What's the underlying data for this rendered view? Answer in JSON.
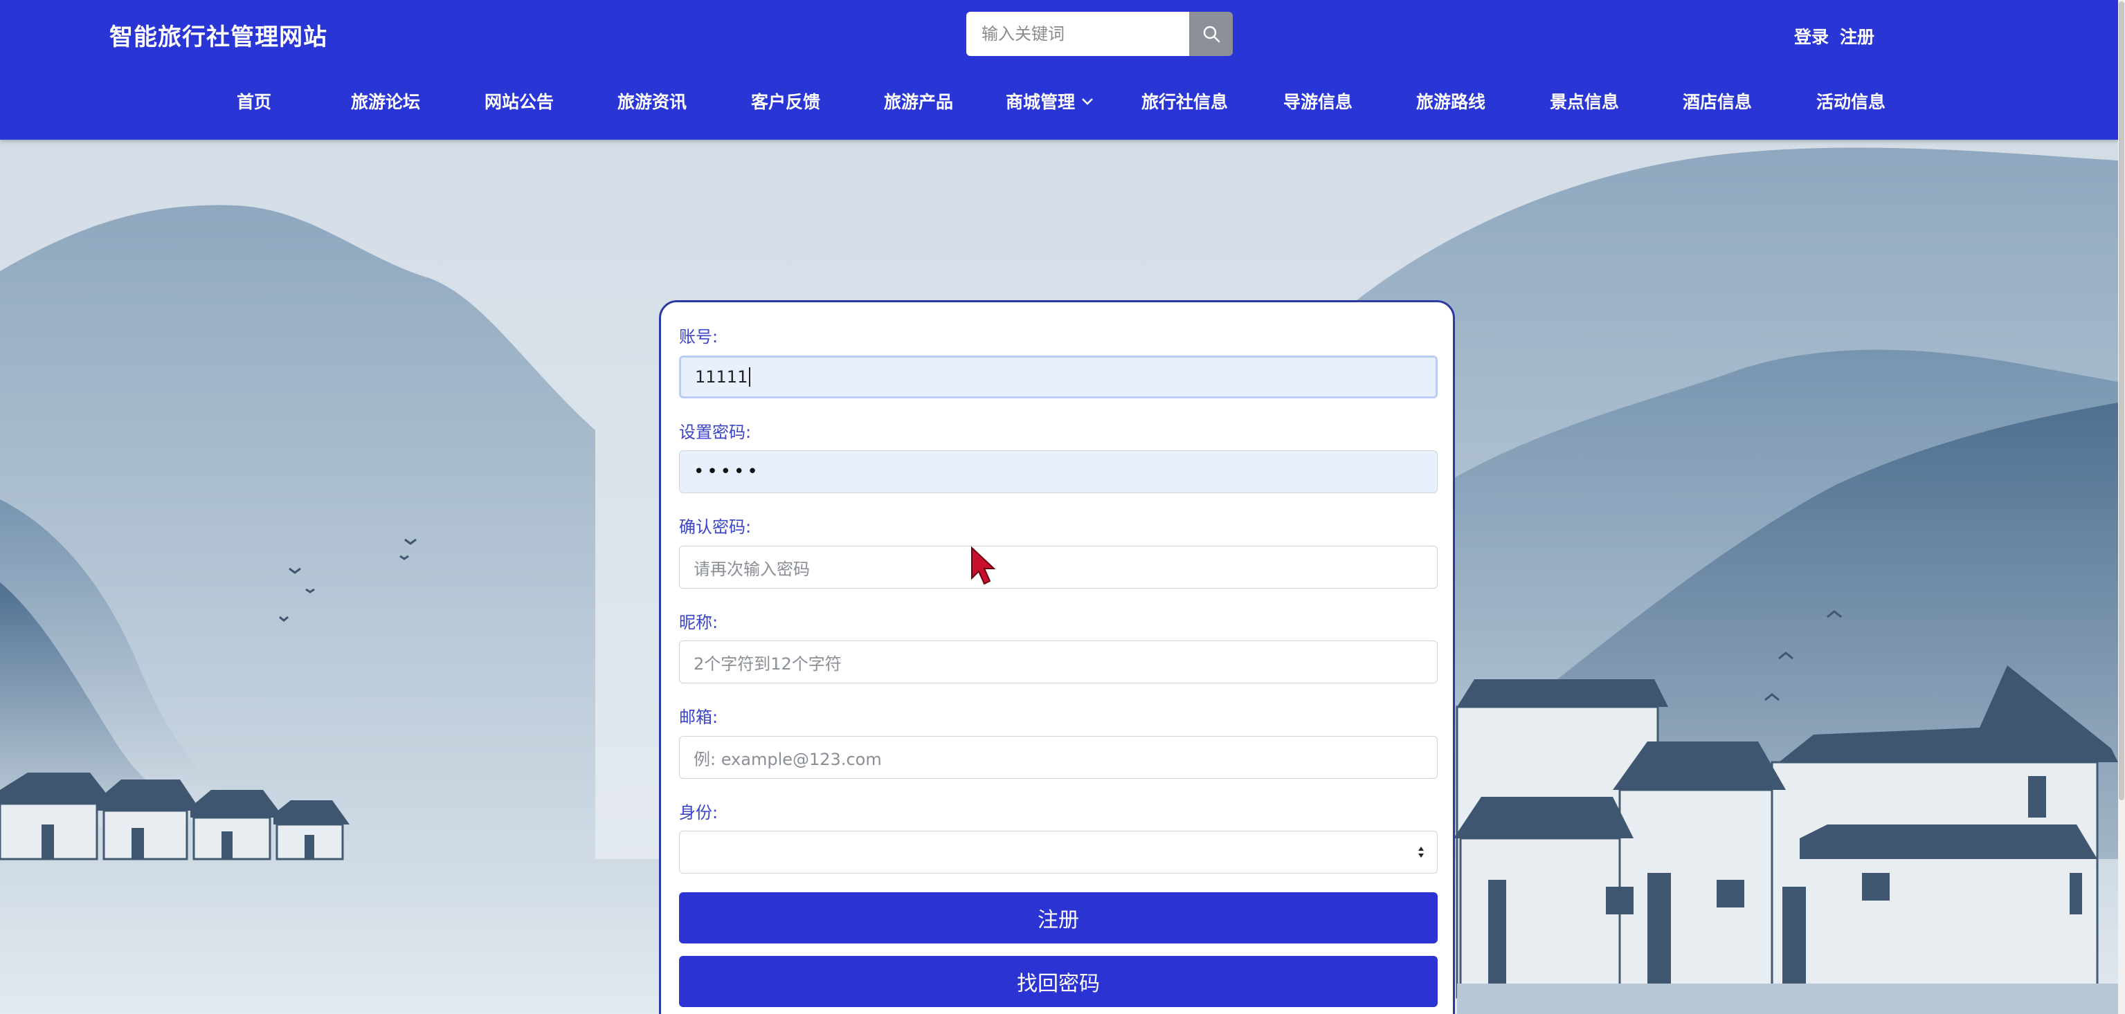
{
  "header": {
    "site_title": "智能旅行社管理网站",
    "search": {
      "placeholder": "输入关键词",
      "icon": "search-icon"
    },
    "auth": {
      "login": "登录",
      "register": "注册"
    }
  },
  "nav": {
    "items": [
      {
        "label": "首页"
      },
      {
        "label": "旅游论坛"
      },
      {
        "label": "网站公告"
      },
      {
        "label": "旅游资讯"
      },
      {
        "label": "客户反馈"
      },
      {
        "label": "旅游产品"
      },
      {
        "label": "商城管理",
        "icon": "chevron-down-icon"
      },
      {
        "label": "旅行社信息"
      },
      {
        "label": "导游信息"
      },
      {
        "label": "旅游路线"
      },
      {
        "label": "景点信息"
      },
      {
        "label": "酒店信息"
      },
      {
        "label": "活动信息"
      }
    ]
  },
  "form": {
    "account": {
      "label": "账号:",
      "value": "11111"
    },
    "password": {
      "label": "设置密码:",
      "value": "•••••"
    },
    "confirm_password": {
      "label": "确认密码:",
      "placeholder": "请再次输入密码"
    },
    "nickname": {
      "label": "昵称:",
      "placeholder": "2个字符到12个字符"
    },
    "email": {
      "label": "邮箱:",
      "placeholder": "例: example@123.com"
    },
    "identity": {
      "label": "身份:",
      "value": ""
    },
    "register_button": "注册",
    "recover_button": "找回密码"
  },
  "colors": {
    "brand": "#2a35d6",
    "label": "#3a44c9",
    "card_border": "#2b3a9e"
  }
}
